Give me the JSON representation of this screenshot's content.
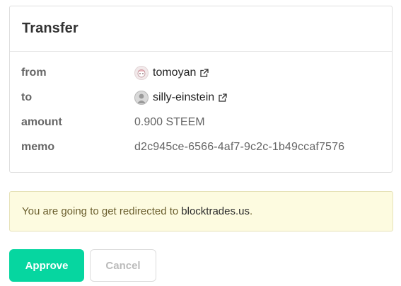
{
  "card": {
    "title": "Transfer",
    "rows": {
      "from": {
        "label": "from",
        "value": "tomoyan",
        "icon": "external-link-icon"
      },
      "to": {
        "label": "to",
        "value": "silly-einstein",
        "icon": "external-link-icon"
      },
      "amount": {
        "label": "amount",
        "value": "0.900 STEEM"
      },
      "memo": {
        "label": "memo",
        "value": "d2c945ce-6566-4af7-9c2c-1b49ccaf7576"
      }
    }
  },
  "notice": {
    "text": "You are going to get redirected to",
    "link": "blocktrades.us",
    "suffix": "."
  },
  "buttons": {
    "approve": "Approve",
    "cancel": "Cancel"
  },
  "colors": {
    "accent": "#06d6a0",
    "notice_bg": "#fdfbe0",
    "notice_text": "#6b5f2e"
  }
}
